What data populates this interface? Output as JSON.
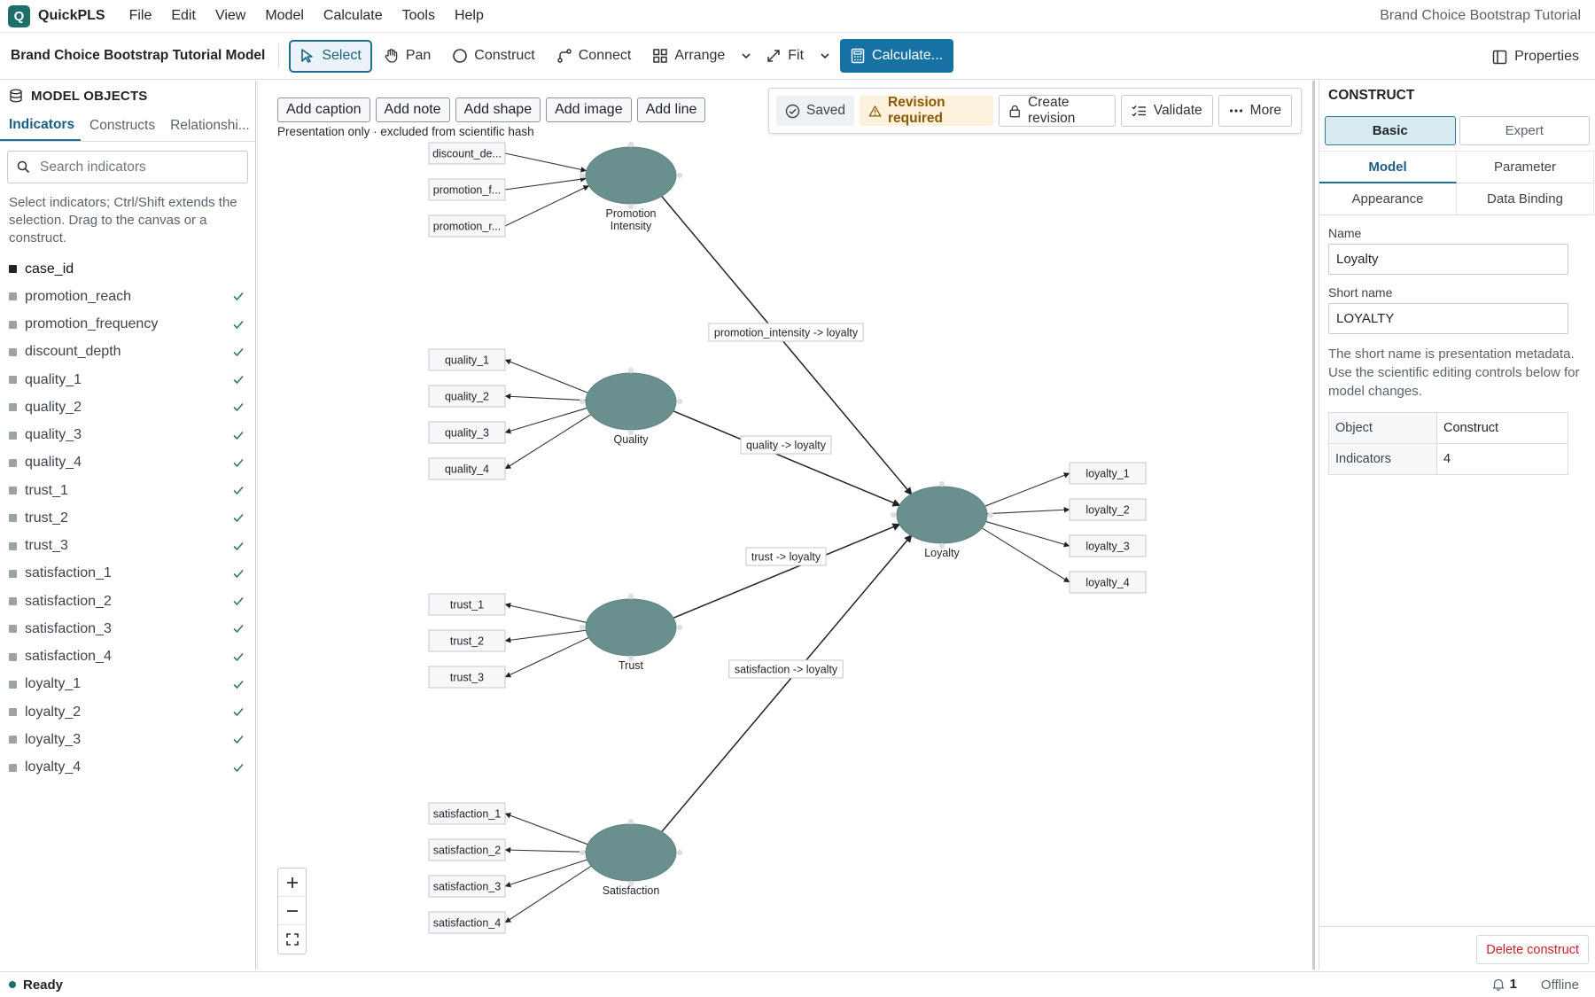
{
  "app": {
    "logo_letter": "Q",
    "name": "QuickPLS",
    "window_title": "Brand Choice Bootstrap Tutorial"
  },
  "menu": [
    "File",
    "Edit",
    "View",
    "Model",
    "Calculate",
    "Tools",
    "Help"
  ],
  "toolbar": {
    "model_title": "Brand Choice Bootstrap Tutorial Model",
    "tools": [
      {
        "label": "Select",
        "icon": "cursor-icon",
        "active": true
      },
      {
        "label": "Pan",
        "icon": "hand-icon"
      },
      {
        "label": "Construct",
        "icon": "circle-icon"
      },
      {
        "label": "Connect",
        "icon": "connect-icon"
      },
      {
        "label": "Arrange",
        "icon": "grid-icon"
      },
      {
        "label": "Fit",
        "icon": "expand-icon"
      }
    ],
    "calculate_label": "Calculate...",
    "properties_label": "Properties"
  },
  "left_panel": {
    "title": "MODEL OBJECTS",
    "tabs": [
      "Indicators",
      "Constructs",
      "Relationshi..."
    ],
    "active_tab": "Indicators",
    "search_placeholder": "Search indicators",
    "help": "Select indicators; Ctrl/Shift extends the selection. Drag to the canvas or a construct.",
    "indicators": [
      {
        "name": "case_id",
        "assigned": false
      },
      {
        "name": "promotion_reach",
        "assigned": true
      },
      {
        "name": "promotion_frequency",
        "assigned": true
      },
      {
        "name": "discount_depth",
        "assigned": true
      },
      {
        "name": "quality_1",
        "assigned": true
      },
      {
        "name": "quality_2",
        "assigned": true
      },
      {
        "name": "quality_3",
        "assigned": true
      },
      {
        "name": "quality_4",
        "assigned": true
      },
      {
        "name": "trust_1",
        "assigned": true
      },
      {
        "name": "trust_2",
        "assigned": true
      },
      {
        "name": "trust_3",
        "assigned": true
      },
      {
        "name": "satisfaction_1",
        "assigned": true
      },
      {
        "name": "satisfaction_2",
        "assigned": true
      },
      {
        "name": "satisfaction_3",
        "assigned": true
      },
      {
        "name": "satisfaction_4",
        "assigned": true
      },
      {
        "name": "loyalty_1",
        "assigned": true
      },
      {
        "name": "loyalty_2",
        "assigned": true
      },
      {
        "name": "loyalty_3",
        "assigned": true
      },
      {
        "name": "loyalty_4",
        "assigned": true
      }
    ]
  },
  "canvas": {
    "annotation_tools": [
      "Add caption",
      "Add note",
      "Add shape",
      "Add image",
      "Add line"
    ],
    "annotation_note": "Presentation only · excluded from scientific hash",
    "status": {
      "saved": "Saved",
      "revision": "Revision required",
      "create_revision": "Create revision",
      "validate": "Validate",
      "more": "More"
    },
    "model": {
      "node_color": "#6a8f8f",
      "constructs": [
        {
          "id": "promo",
          "label": [
            "Promotion",
            "Intensity"
          ],
          "indicators": [
            "discount_de...",
            "promotion_f...",
            "promotion_r..."
          ],
          "direction": "in"
        },
        {
          "id": "quality",
          "label": [
            "Quality"
          ],
          "indicators": [
            "quality_1",
            "quality_2",
            "quality_3",
            "quality_4"
          ],
          "direction": "out"
        },
        {
          "id": "trust",
          "label": [
            "Trust"
          ],
          "indicators": [
            "trust_1",
            "trust_2",
            "trust_3"
          ],
          "direction": "out"
        },
        {
          "id": "satisfaction",
          "label": [
            "Satisfaction"
          ],
          "indicators": [
            "satisfaction_1",
            "satisfaction_2",
            "satisfaction_3",
            "satisfaction_4"
          ],
          "direction": "out"
        },
        {
          "id": "loyalty",
          "label": [
            "Loyalty"
          ],
          "indicators": [
            "loyalty_1",
            "loyalty_2",
            "loyalty_3",
            "loyalty_4"
          ],
          "direction": "out"
        }
      ],
      "paths": [
        {
          "from": "promo",
          "to": "loyalty",
          "label": "promotion_intensity -> loyalty"
        },
        {
          "from": "quality",
          "to": "loyalty",
          "label": "quality -> loyalty"
        },
        {
          "from": "trust",
          "to": "loyalty",
          "label": "trust -> loyalty"
        },
        {
          "from": "satisfaction",
          "to": "loyalty",
          "label": "satisfaction -> loyalty"
        }
      ]
    }
  },
  "right_panel": {
    "title": "CONSTRUCT",
    "modes": [
      "Basic",
      "Expert"
    ],
    "active_mode": "Basic",
    "tabs": [
      "Model",
      "Parameter",
      "Appearance",
      "Data Binding"
    ],
    "active_tab": "Model",
    "name_label": "Name",
    "name_value": "Loyalty",
    "short_name_label": "Short name",
    "short_name_value": "LOYALTY",
    "help": "The short name is presentation metadata. Use the scientific editing controls below for model changes.",
    "info": [
      {
        "key": "Object",
        "value": "Construct"
      },
      {
        "key": "Indicators",
        "value": "4"
      }
    ],
    "delete_label": "Delete construct"
  },
  "statusbar": {
    "status": "Ready",
    "notifications": "1",
    "connection": "Offline"
  }
}
